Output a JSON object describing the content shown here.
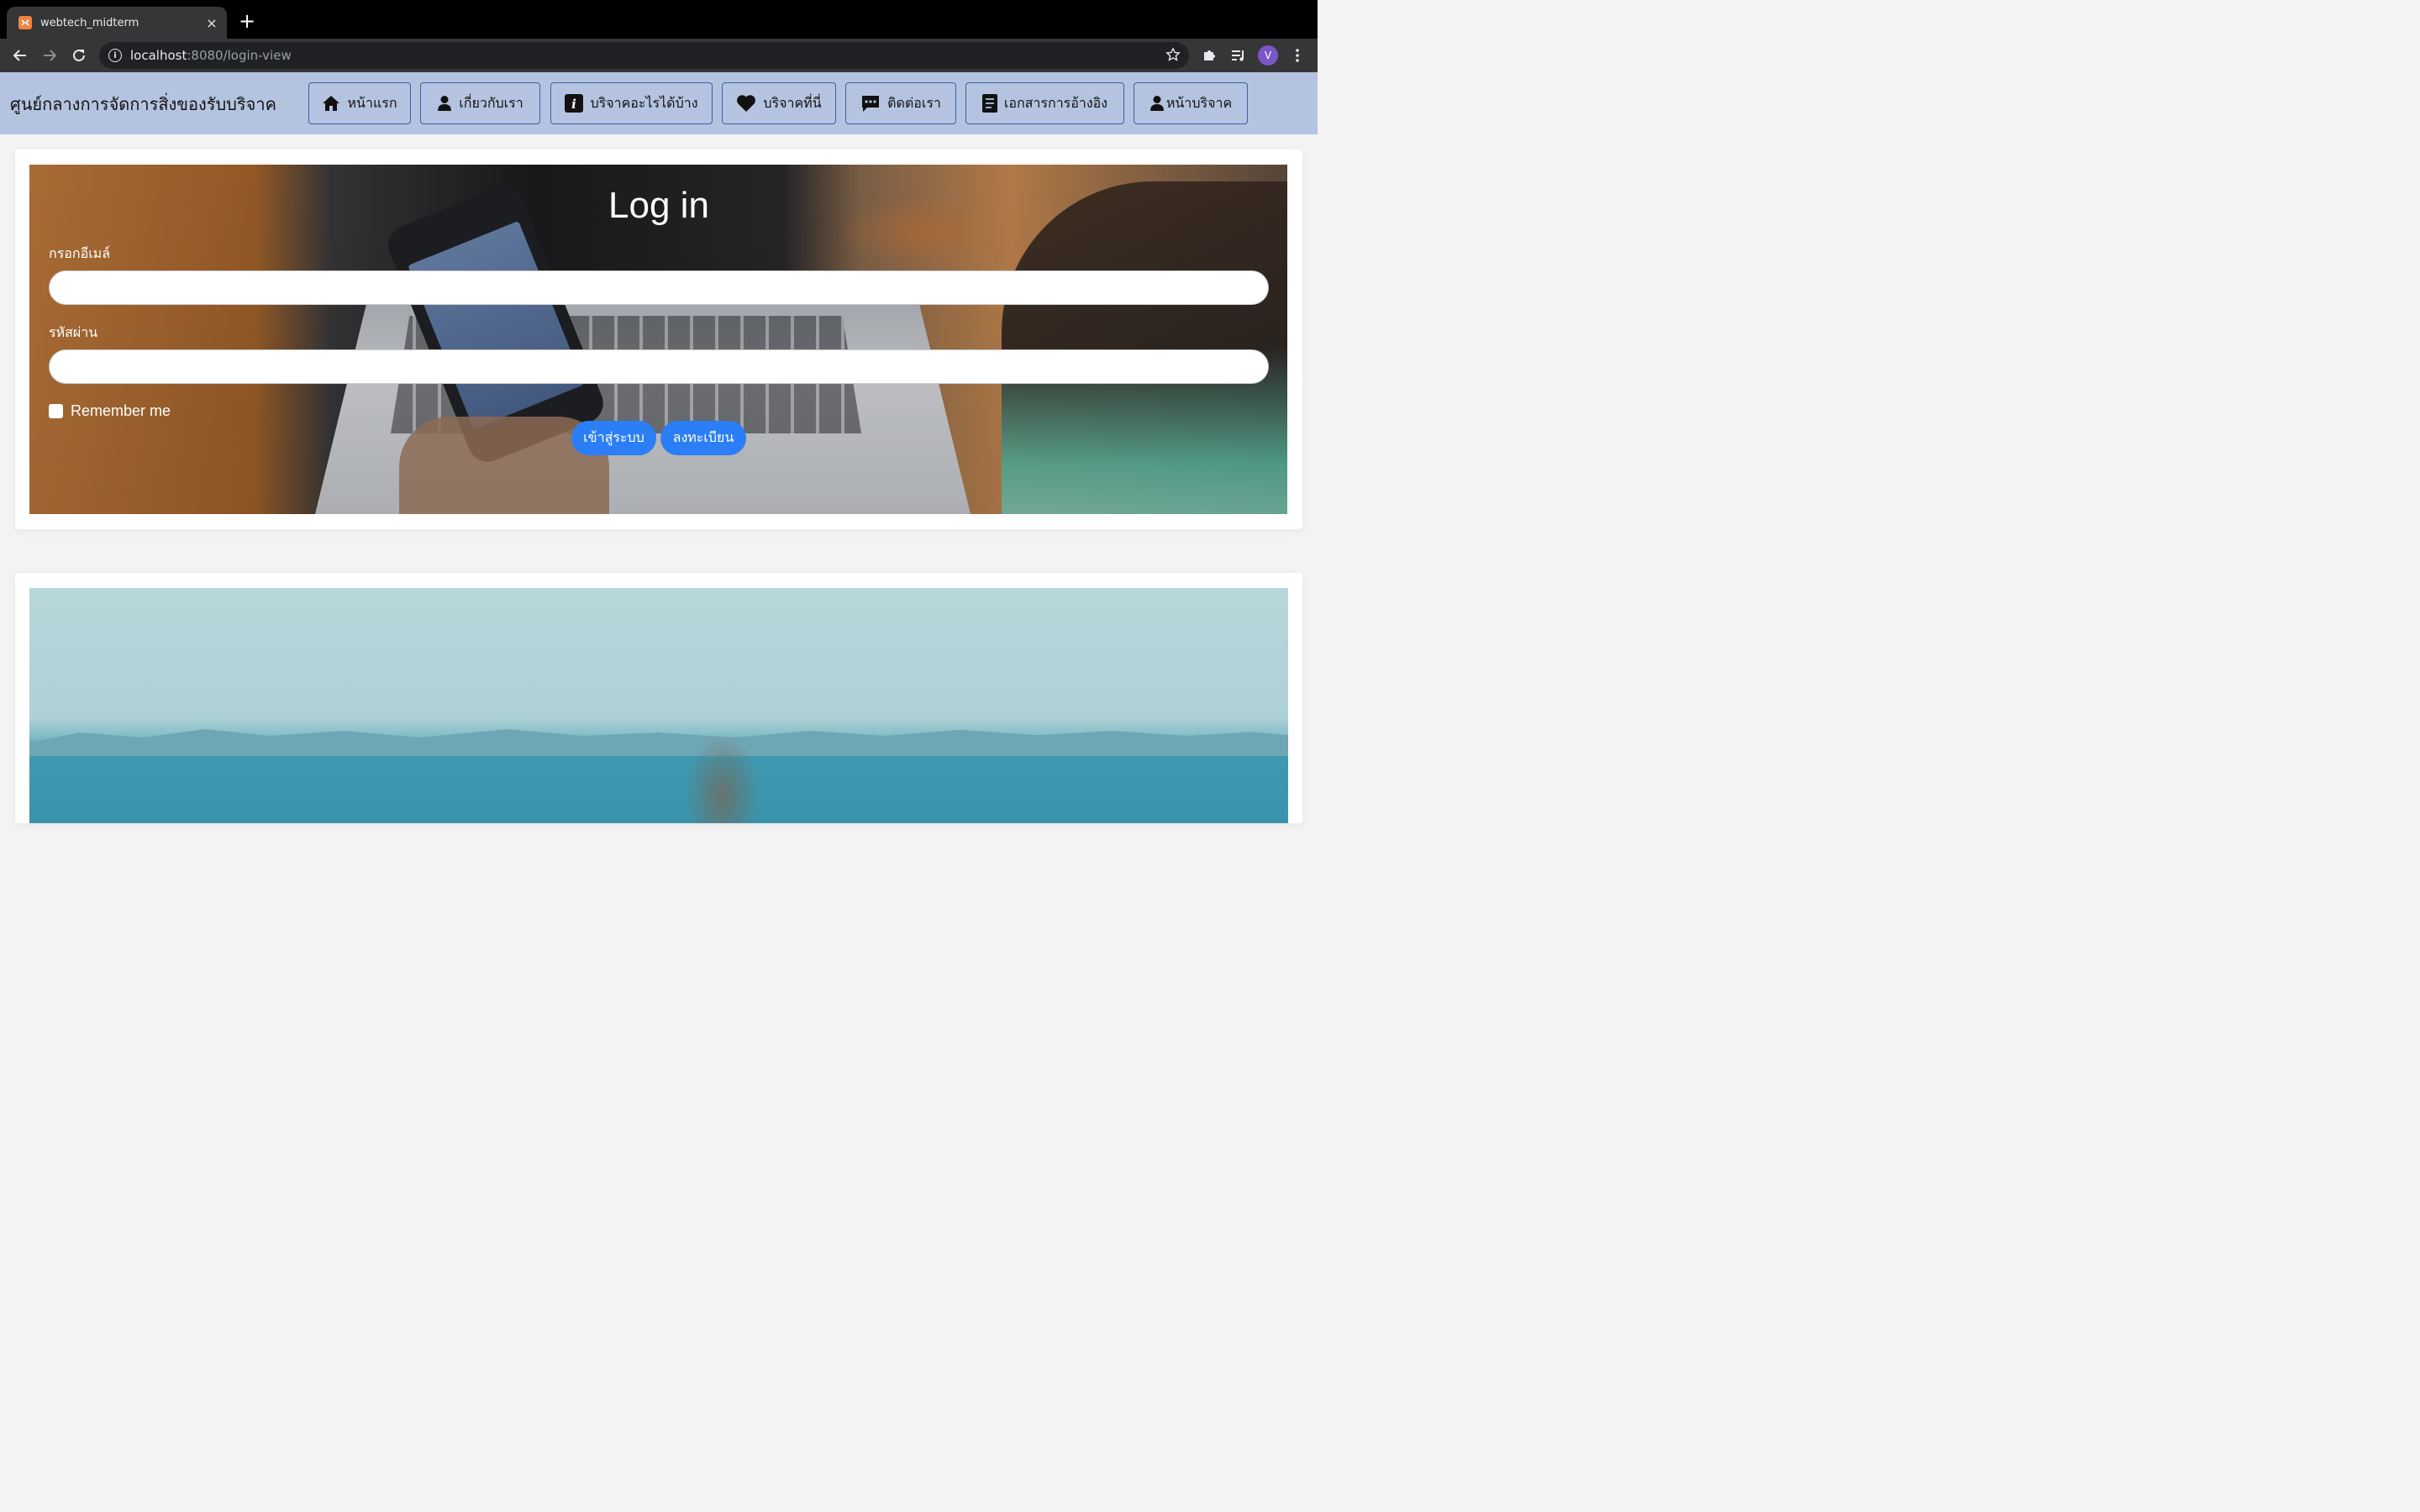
{
  "browser": {
    "tab_title": "webtech_midterm",
    "tab_close": "×",
    "new_tab": "+",
    "url_host": "localhost",
    "url_rest": ":8080/login-view",
    "profile_initial": "V",
    "info_glyph": "i"
  },
  "site": {
    "brand": "ศูนย์กลางการจัดการสิ่งของรับบริจาค",
    "nav": [
      {
        "label": "หน้าแรก",
        "icon": "home-icon"
      },
      {
        "label": "เกี่ยวกับเรา",
        "icon": "user-icon"
      },
      {
        "label": "บริจาคอะไรได้บ้าง",
        "icon": "info-icon"
      },
      {
        "label": "บริจาคที่นี่",
        "icon": "heart-icon"
      },
      {
        "label": "ติดต่อเรา",
        "icon": "chat-icon"
      },
      {
        "label": "เอกสารการอ้างอิง",
        "icon": "document-icon"
      },
      {
        "label": "หน้าบริจาค",
        "icon": "user-icon"
      }
    ],
    "nav_info_glyph": "i"
  },
  "login": {
    "title": "Log in",
    "email_label": "กรอกอีเมล์",
    "email_value": "",
    "password_label": "รหัสผ่าน",
    "password_value": "",
    "remember_label": "Remember me",
    "remember_checked": false,
    "login_button": "เข้าสู่ระบบ",
    "register_button": "ลงทะเบียน"
  },
  "colors": {
    "navbar_bg": "#b4c4e0",
    "nav_border": "#3b5fa8",
    "primary_button": "#2b7ef5",
    "chrome_dark": "#353638",
    "avatar": "#7b57c8"
  }
}
